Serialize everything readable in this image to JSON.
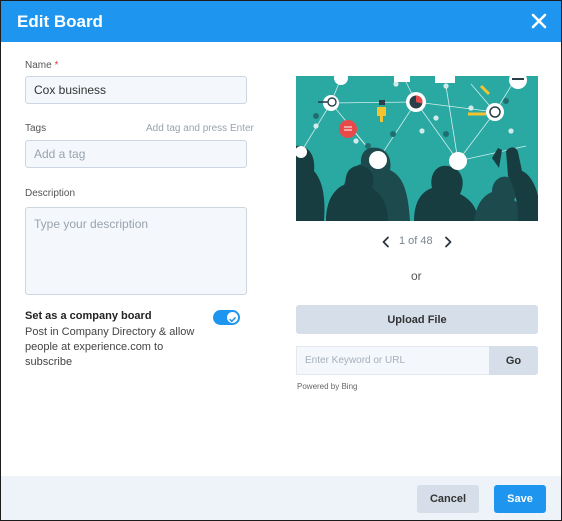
{
  "dialog": {
    "title": "Edit Board"
  },
  "form": {
    "name_label": "Name",
    "name_required_mark": "*",
    "name_value": "Cox business",
    "tags_label": "Tags",
    "tags_hint": "Add tag and press Enter",
    "tags_placeholder": "Add a tag",
    "description_label": "Description",
    "description_placeholder": "Type your description",
    "company_title": "Set as a company board",
    "company_description": "Post in Company Directory & allow people at experience.com to subscribe",
    "company_toggle_on": true
  },
  "image": {
    "page_count": "1 of 48",
    "or_label": "or",
    "upload_label": "Upload File",
    "search_placeholder": "Enter Keyword or URL",
    "go_label": "Go",
    "powered_by": "Powered by Bing"
  },
  "footer": {
    "cancel_label": "Cancel",
    "save_label": "Save"
  },
  "colors": {
    "accent": "#1e96f0",
    "image_background": "#2aa9a3",
    "silhouette": "#173d40"
  },
  "icons": {
    "close": "close-icon",
    "prev": "chevron-left-icon",
    "next": "chevron-right-icon",
    "toggle": "checkmark-icon"
  }
}
